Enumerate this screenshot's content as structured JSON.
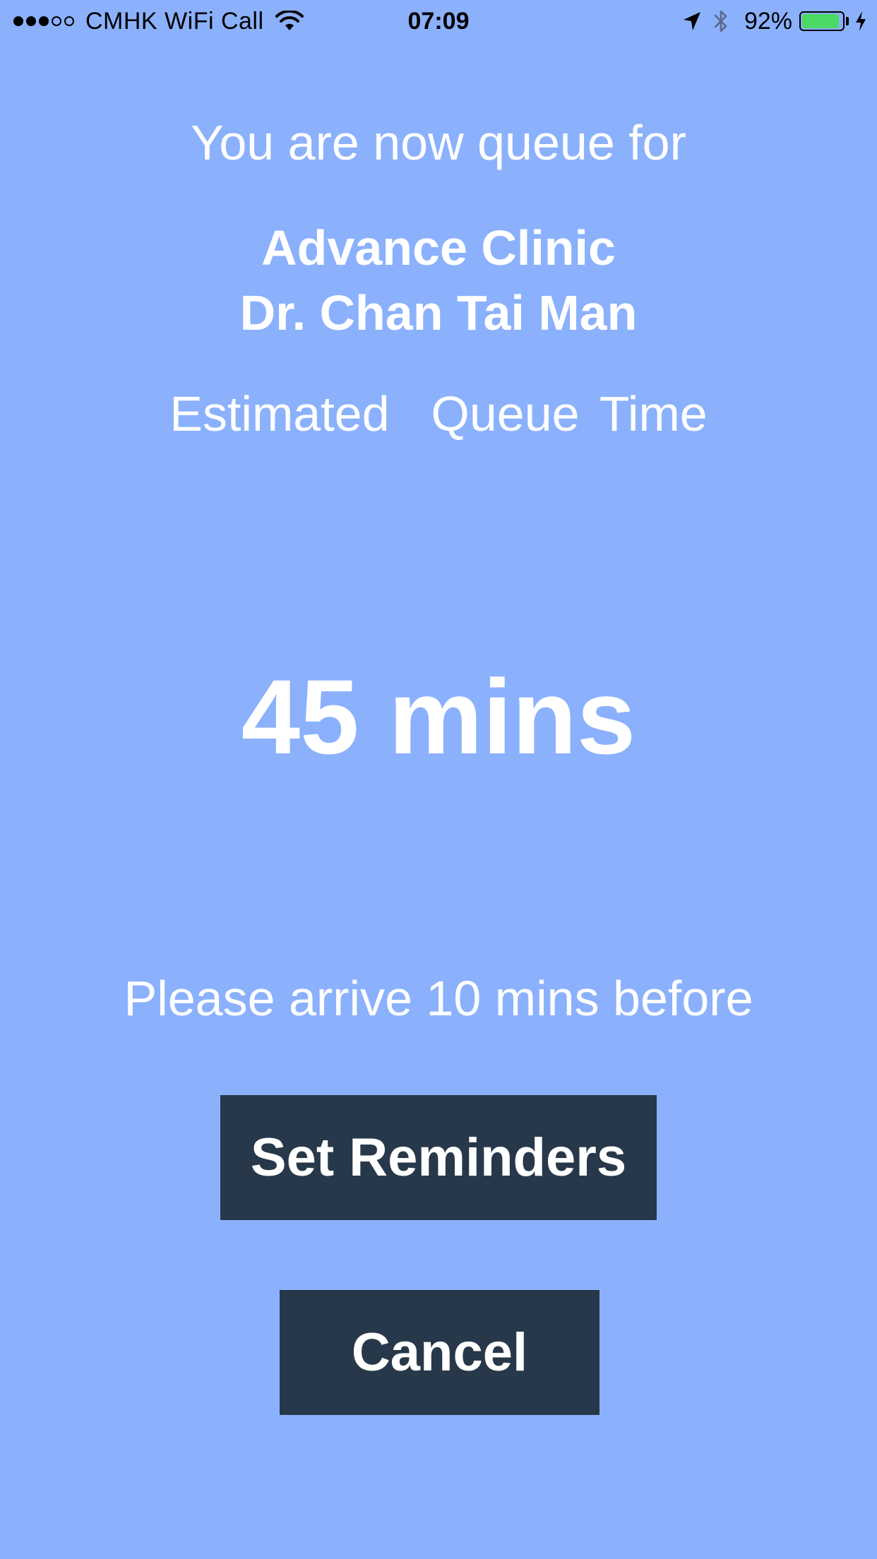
{
  "status_bar": {
    "signal_filled": 3,
    "signal_total": 5,
    "carrier": "CMHK WiFi Call",
    "time": "07:09",
    "battery_percent": "92%",
    "battery_level": 0.92,
    "battery_color": "#4CD964",
    "icons": [
      "wifi-icon",
      "location-arrow-icon",
      "bluetooth-icon",
      "battery-icon",
      "charging-bolt-icon"
    ]
  },
  "queue": {
    "intro": "You are now queue for",
    "clinic": "Advance Clinic",
    "doctor": "Dr. Chan Tai Man",
    "estimated_label": "Estimated  Queue Time",
    "time": "45 mins",
    "arrive_note": "Please arrive 10 mins before"
  },
  "buttons": {
    "set_reminders": "Set Reminders",
    "cancel": "Cancel"
  },
  "colors": {
    "background": "#8BB1FD",
    "button": "#27384A",
    "text": "#FFFFFF"
  }
}
